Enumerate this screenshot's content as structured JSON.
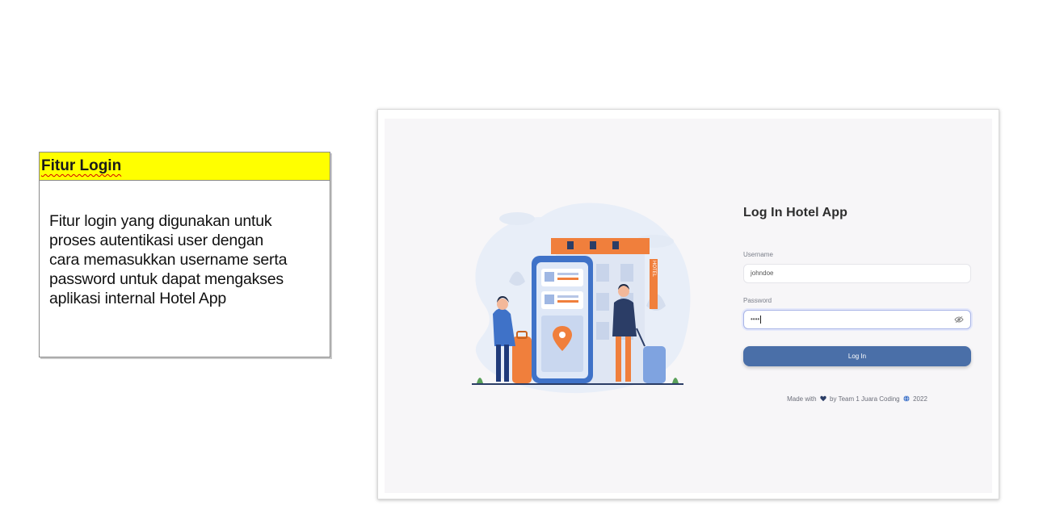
{
  "note": {
    "title": "Fitur Login",
    "lines": [
      "Fitur login yang digunakan untuk",
      "proses autentikasi user dengan",
      "cara memasukkan username serta",
      "password untuk dapat mengakses",
      "aplikasi internal Hotel App"
    ]
  },
  "login": {
    "title": "Log In Hotel App",
    "username_label": "Username",
    "username_value": "johndoe",
    "password_label": "Password",
    "password_value": "••••",
    "button_label": "Log In",
    "footer_pre": "Made with",
    "footer_mid": "by Team 1 Juara Coding",
    "footer_year": "2022"
  },
  "illustration": {
    "hotel_sign": "HOTEL"
  },
  "colors": {
    "note_title_bg": "#ffff00",
    "button": "#4a6fa8",
    "accent_orange": "#f07f3c",
    "phone_blue": "#3f72c8"
  },
  "icons": [
    "eye-icon",
    "heart-icon",
    "globe-icon"
  ]
}
